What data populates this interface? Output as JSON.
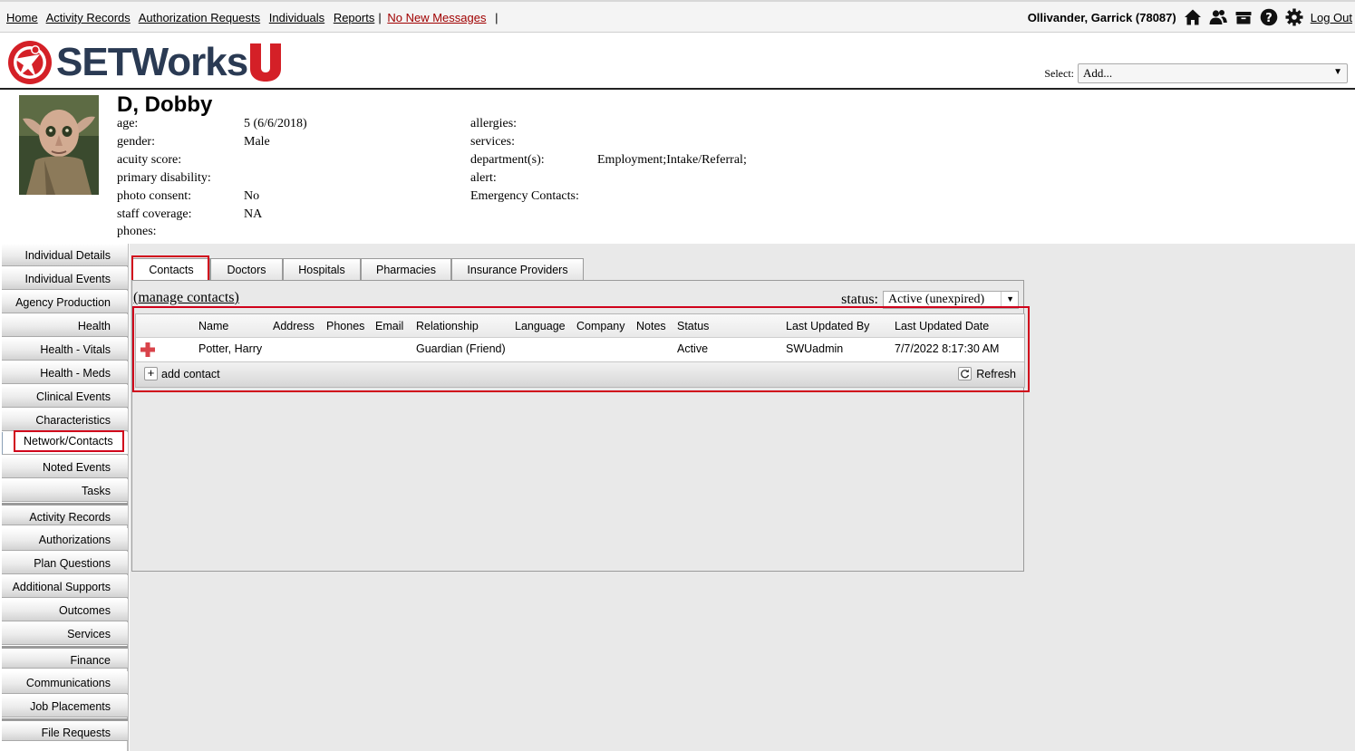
{
  "topnav": {
    "links": [
      "Home",
      "Activity Records",
      "Authorization Requests",
      "Individuals",
      "Reports"
    ],
    "separator": "|",
    "messages": "No New Messages",
    "user": "Ollivander, Garrick  (78087)",
    "logout": "Log Out"
  },
  "logo": {
    "text": "SETWorks",
    "letter": "U"
  },
  "select": {
    "label": "Select:",
    "value": "Add..."
  },
  "person": {
    "name": "D, Dobby",
    "left_fields": [
      {
        "label": "age:",
        "value": "5 (6/6/2018)"
      },
      {
        "label": "gender:",
        "value": "Male"
      },
      {
        "label": "acuity score:",
        "value": ""
      },
      {
        "label": "primary disability:",
        "value": ""
      },
      {
        "label": "photo consent:",
        "value": "No"
      },
      {
        "label": "staff coverage:",
        "value": "NA"
      },
      {
        "label": "phones:",
        "value": ""
      }
    ],
    "right_fields": [
      {
        "label": "allergies:",
        "value": ""
      },
      {
        "label": "services:",
        "value": ""
      },
      {
        "label": "department(s):",
        "value": "Employment;Intake/Referral;"
      },
      {
        "label": "alert:",
        "value": ""
      },
      {
        "label": "Emergency Contacts:",
        "value": ""
      }
    ]
  },
  "sidebar": {
    "items": [
      "Individual Details",
      "Individual Events",
      "Agency Production",
      "Health",
      "Health - Vitals",
      "Health - Meds",
      "Clinical Events",
      "Characteristics",
      "Network/Contacts",
      "Noted Events",
      "Tasks",
      "Activity Records",
      "Authorizations",
      "Plan Questions",
      "Additional Supports",
      "Outcomes",
      "Services",
      "Finance",
      "Communications",
      "Job Placements",
      "File Requests"
    ],
    "active": "Network/Contacts"
  },
  "tabs": [
    "Contacts",
    "Doctors",
    "Hospitals",
    "Pharmacies",
    "Insurance Providers"
  ],
  "active_tab": "Contacts",
  "panel": {
    "manage_link": "(manage contacts)",
    "status_label": "status:",
    "status_value": "Active (unexpired)"
  },
  "grid": {
    "columns": [
      "Name",
      "Address",
      "Phones",
      "Email",
      "Relationship",
      "Language",
      "Company",
      "Notes",
      "Status",
      "Last Updated By",
      "Last Updated Date"
    ],
    "rows": [
      [
        "Potter, Harry",
        "",
        "",
        "",
        "Guardian (Friend)",
        "",
        "",
        "",
        "Active",
        "SWUadmin",
        "7/7/2022 8:17:30 AM"
      ]
    ],
    "add_label": "add contact",
    "refresh_label": "Refresh"
  },
  "colors": {
    "highlight": "#d0021b",
    "logo_red": "#d42027",
    "logo_navy": "#2a3a53",
    "link_red": "#a00000"
  }
}
